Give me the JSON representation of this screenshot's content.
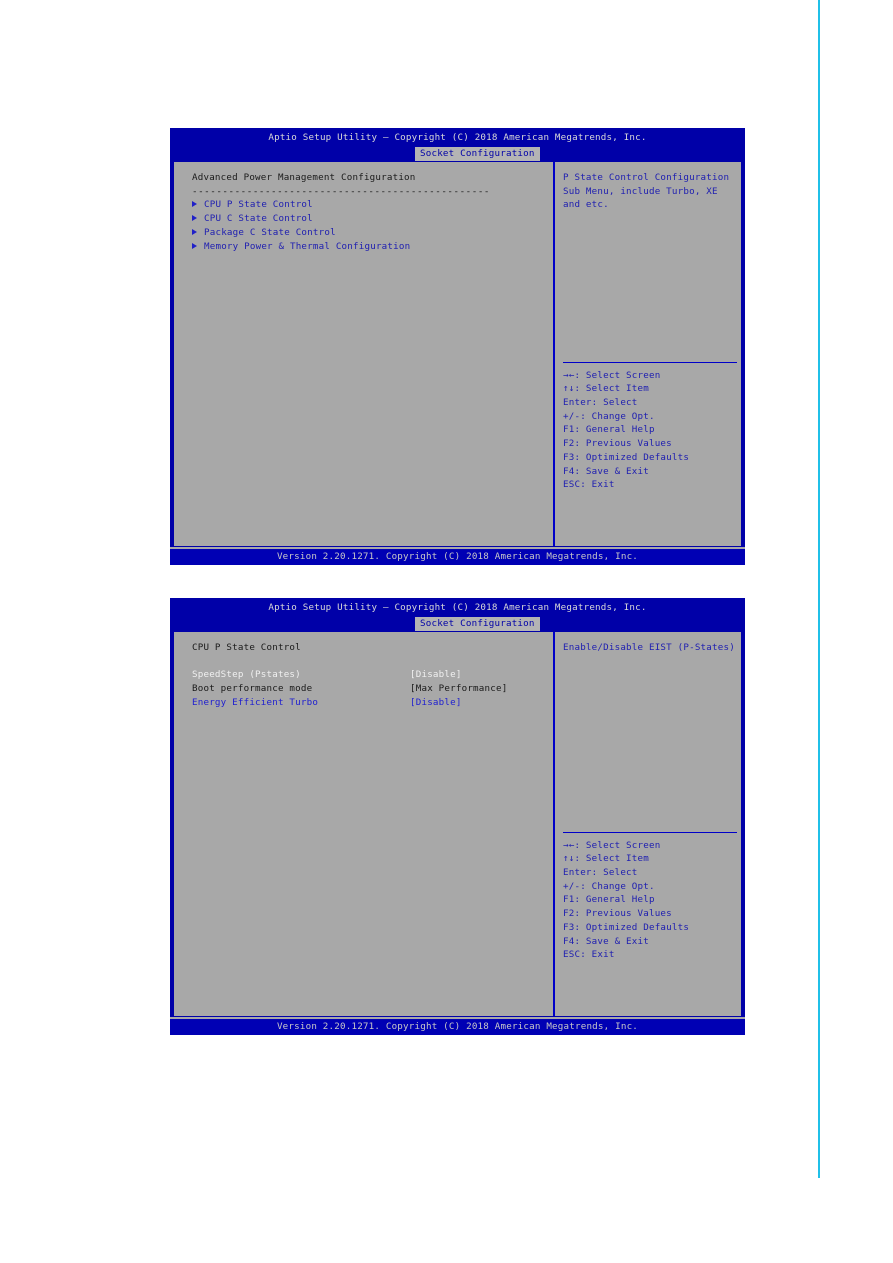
{
  "screens": [
    {
      "titlebar": "Aptio Setup Utility – Copyright (C) 2018 American Megatrends, Inc.",
      "tab": "Socket Configuration",
      "heading": "Advanced Power Management Configuration",
      "divider": "-------------------------------------------------",
      "menu_items": [
        {
          "label": "CPU P State Control"
        },
        {
          "label": "CPU C State Control"
        },
        {
          "label": "Package C State Control"
        },
        {
          "label": "Memory Power & Thermal Configuration"
        }
      ],
      "help_lines": [
        "P State Control Configuration",
        "Sub Menu, include Turbo, XE",
        "and etc."
      ],
      "keys": [
        "→←: Select Screen",
        "↑↓: Select Item",
        "Enter: Select",
        "+/-: Change Opt.",
        "F1: General Help",
        "F2: Previous Values",
        "F3: Optimized Defaults",
        "F4: Save & Exit",
        "ESC: Exit"
      ],
      "footer": "Version 2.20.1271. Copyright (C) 2018 American Megatrends, Inc."
    },
    {
      "titlebar": "Aptio Setup Utility – Copyright (C) 2018 American Megatrends, Inc.",
      "tab": "Socket Configuration",
      "heading": "CPU P State Control",
      "settings": [
        {
          "label": "SpeedStep (Pstates)",
          "value": "[Disable]",
          "state": "normal"
        },
        {
          "label": "Boot performance mode",
          "value": "[Max Performance]",
          "state": "dark"
        },
        {
          "label": "Energy Efficient Turbo",
          "value": "[Disable]",
          "state": "active"
        }
      ],
      "help_lines": [
        "Enable/Disable EIST (P-States)"
      ],
      "keys": [
        "→←: Select Screen",
        "↑↓: Select Item",
        "Enter: Select",
        "+/-: Change Opt.",
        "F1: General Help",
        "F2: Previous Values",
        "F3: Optimized Defaults",
        "F4: Save & Exit",
        "ESC: Exit"
      ],
      "footer": "Version 2.20.1271. Copyright (C) 2018 American Megatrends, Inc."
    }
  ],
  "colors": {
    "header_blue": "#0000a8",
    "body_gray": "#a8a8a8",
    "accent_blue": "#2020b0",
    "page_guide": "#20c0e8"
  }
}
